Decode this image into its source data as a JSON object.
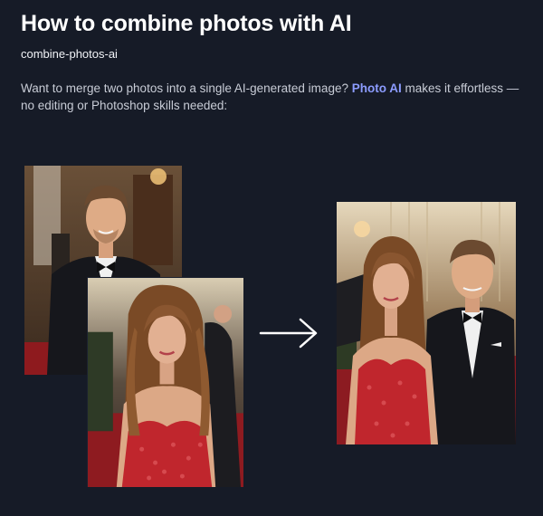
{
  "article": {
    "title": "How to combine photos with AI",
    "slug": "combine-photos-ai",
    "intro_before": "Want to merge two photos into a single AI-generated image? ",
    "intro_link": "Photo AI",
    "intro_after": " makes it effortless — no editing or Photoshop skills needed:"
  },
  "images": {
    "input_man": "man-in-tuxedo-photo",
    "input_woman": "woman-in-red-dress-photo",
    "output": "combined-couple-photo",
    "arrow": "right-arrow-icon"
  },
  "colors": {
    "background": "#161b27",
    "link": "#8c9cff",
    "dress_red": "#c0262d"
  }
}
